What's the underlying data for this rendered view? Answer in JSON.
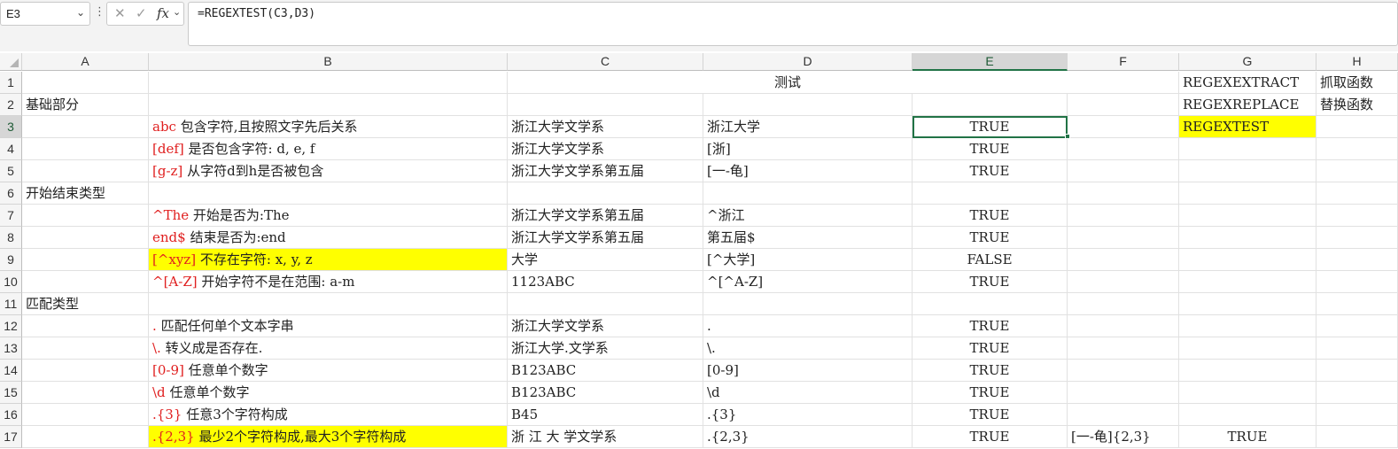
{
  "formula_bar": {
    "name_box": "E3",
    "formula": "=REGEXTEST(C3,D3)"
  },
  "icons": {
    "name_box_dropdown": "chevron-down-icon",
    "more": "vertical-dots-icon",
    "cancel": "x-icon",
    "enter": "check-icon",
    "fx": "function-icon"
  },
  "colors": {
    "selection": "#217346",
    "highlight": "#ffff00",
    "pattern_red": "#e02020"
  },
  "columns": [
    "A",
    "B",
    "C",
    "D",
    "E",
    "F",
    "G",
    "H"
  ],
  "selected_column": "E",
  "rows": [
    "1",
    "2",
    "3",
    "4",
    "5",
    "6",
    "7",
    "8",
    "9",
    "10",
    "11",
    "12",
    "13",
    "14",
    "15",
    "16",
    "17"
  ],
  "selected_row": "3",
  "cells": {
    "D1": "测试",
    "G1": "REGEXEXTRACT",
    "H1": "抓取函数",
    "A2": "基础部分",
    "G2": "REGEXREPLACE",
    "H2": "替换函数",
    "B3p": "abc",
    "B3d": "包含字符,且按照文字先后关系",
    "C3": "浙江大学文学系",
    "D3": "浙江大学",
    "E3": "TRUE",
    "G3": "REGEXTEST",
    "B4p": "[def]",
    "B4d": "是否包含字符: d, e, f",
    "C4": "浙江大学文学系",
    "D4": "[浙]",
    "E4": "TRUE",
    "B5p": "[g-z]",
    "B5d": "从字符d到h是否被包含",
    "C5": "浙江大学文学系第五届",
    "D5": "[一-龟]",
    "E5": "TRUE",
    "A6": "开始结束类型",
    "B7p": "^The",
    "B7d": "开始是否为:The",
    "C7": "浙江大学文学系第五届",
    "D7": "^浙江",
    "E7": "TRUE",
    "B8p": "end$",
    "B8d": "结束是否为:end",
    "C8": "浙江大学文学系第五届",
    "D8": "第五届$",
    "E8": "TRUE",
    "B9p": "[^xyz]",
    "B9d": "不存在字符: x, y, z",
    "C9": "大学",
    "D9": "[^大学]",
    "E9": "FALSE",
    "B10p": "^[A-Z]",
    "B10d": "开始字符不是在范围: a-m",
    "C10": "1123ABC",
    "D10": "^[^A-Z]",
    "E10": "TRUE",
    "A11": "匹配类型",
    "B12p": ".",
    "B12d": "匹配任何单个文本字串",
    "C12": "浙江大学文学系",
    "D12": ".",
    "E12": "TRUE",
    "B13p": "\\.",
    "B13d": "转义成是否存在.",
    "C13": "浙江大学.文学系",
    "D13": "\\.",
    "E13": "TRUE",
    "B14p": "[0-9]",
    "B14d": "任意单个数字",
    "C14": "B123ABC",
    "D14": "[0-9]",
    "E14": "TRUE",
    "B15p": "\\d",
    "B15d": "任意单个数字",
    "C15": "B123ABC",
    "D15": "\\d",
    "E15": "TRUE",
    "B16p": ".{3}",
    "B16d": "任意3个字符构成",
    "C16": "B45",
    "D16": ".{3}",
    "E16": "TRUE",
    "B17p": ".{2,3}",
    "B17d": "最少2个字符构成,最大3个字符构成",
    "C17": "浙 江 大 学文学系",
    "D17": ".{2,3}",
    "E17": "TRUE",
    "F17": "[一-龟]{2,3}",
    "G17": "TRUE"
  }
}
